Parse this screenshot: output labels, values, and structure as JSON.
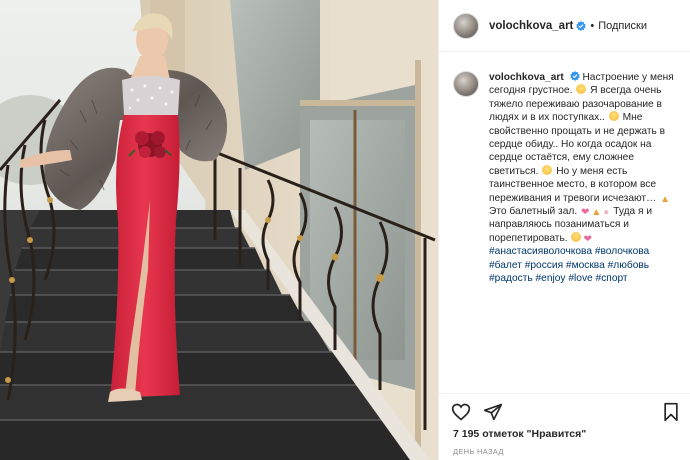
{
  "post": {
    "username": "volochkova_art",
    "follow_separator": "•",
    "follow_label": "Подписки",
    "caption": {
      "username": "volochkova_art",
      "p1": "Настроение у меня сегодня грустное.",
      "p2": "Я всегда очень тяжело переживаю разочарование в людях и в их поступках..",
      "p3": "Мне свойственно прощать и не держать в сердце обиду.. Но когда осадок на сердце остаётся, ему сложнее светиться.",
      "p4": "Но у меня есть таинственное место, в котором все переживания и тревоги исчезают…",
      "p5": "Это балетный зал.",
      "p6": "Туда я и направляюсь позаниматься и порепетировать.",
      "hashtags": "#анастасияволочкова #волочкова #балет #россия #москва #любовь #радость #enjoy #love #спорт"
    },
    "likes": "7 195 отметок \"Нравится\"",
    "posted": "день назад"
  },
  "icons": {
    "verified": "verified-badge-icon",
    "like": "heart-icon",
    "share": "paper-plane-icon",
    "save": "bookmark-icon"
  },
  "colors": {
    "verified": "#3897f0",
    "hashtag": "#00376b",
    "secondary_text": "#8e8e8e",
    "border": "#efefef",
    "dress": "#e0304a"
  }
}
